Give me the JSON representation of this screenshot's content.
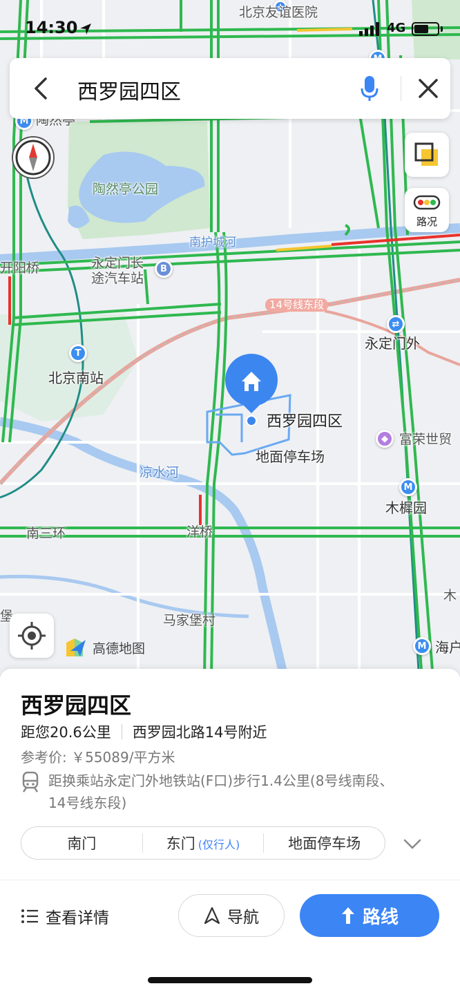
{
  "status_bar": {
    "time": "14:30",
    "network": "4G"
  },
  "search": {
    "query": "西罗园四区"
  },
  "map": {
    "labels": {
      "hospital": "北京友谊医院",
      "taoranting_station": "陶然亭",
      "park": "陶然亭公园",
      "river_south": "南护城河",
      "kaiyang_bridge": "开阳桥",
      "bus_station": "永定门长\n途汽车站",
      "line14": "14号线东段",
      "yongdingmenwai": "永定门外",
      "beijing_south": "北京南站",
      "parking": "地面停车场",
      "mall": "富荣世贸",
      "liangshui_river": "凉水河",
      "mutuyuan": "木樨园",
      "south_ring": "南三环",
      "yangqiao": "洋桥",
      "majiabu": "马家堡村",
      "bao": "堡",
      "haihu": "海户",
      "mu": "木"
    },
    "marker_label": "西罗园四区",
    "traffic_label": "路况",
    "logo_text": "高德地图"
  },
  "place": {
    "title": "西罗园四区",
    "distance": "距您20.6公里",
    "address": "西罗园北路14号附近",
    "price": "参考价: ￥55089/平方米",
    "transit": "距换乘站永定门外地铁站(F口)步行1.4公里(8号线南段、14号线东段)",
    "entrances": [
      {
        "label": "南门",
        "note": ""
      },
      {
        "label": "东门",
        "note": "(仅行人)"
      },
      {
        "label": "地面停车场",
        "note": ""
      }
    ]
  },
  "actions": {
    "details": "查看详情",
    "navigate": "导航",
    "route": "路线"
  },
  "colors": {
    "accent": "#3b85f5",
    "road_green": "#2fb84f",
    "road_red": "#e8322b",
    "road_yellow": "#f4c531",
    "water": "#a8c9f0",
    "park": "#cfe8cf"
  }
}
